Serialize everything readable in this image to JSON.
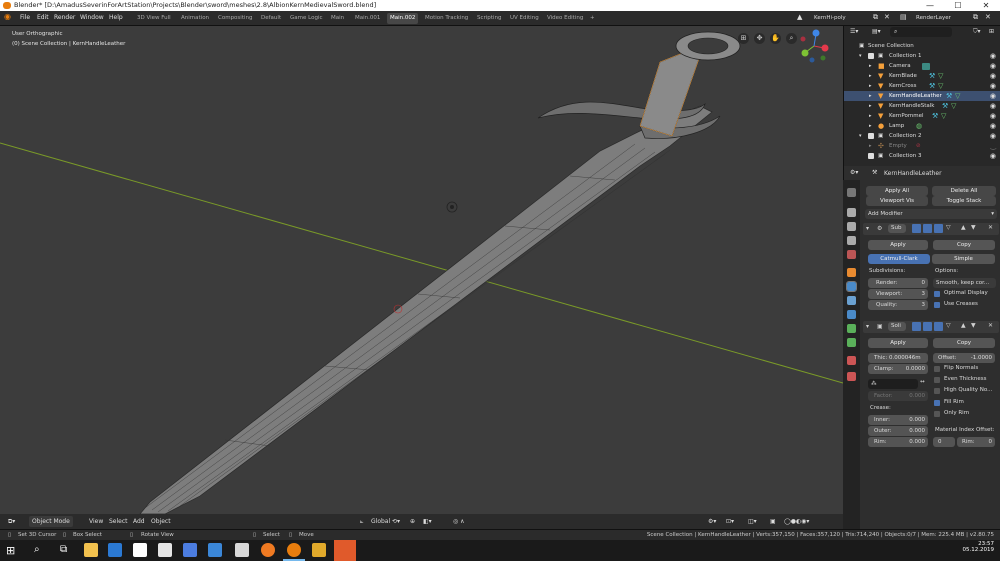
{
  "titlebar": {
    "text": "Blender* [D:\\AmadusSeverinForArtStation\\Projects\\Blender\\sword\\meshes\\2.8\\AlbionKernMedievalSword.blend]",
    "minimize": "—",
    "maximize": "☐",
    "close": "✕"
  },
  "menu": [
    "File",
    "Edit",
    "Render",
    "Window",
    "Help"
  ],
  "workspaces": [
    "3D View Full",
    "Animation",
    "Compositing",
    "Default",
    "Game Logic",
    "Main",
    "Main.001",
    "Main.002",
    "Motion Tracking",
    "Scripting",
    "UV Editing",
    "Video Editing",
    "+"
  ],
  "active_workspace": "Main.002",
  "scene_field": "KernHi-poly",
  "layer_field": "RenderLayer",
  "viewport": {
    "view_name": "User Orthographic",
    "collection_info": "(0) Scene Collection | KernHandleLeather",
    "axis_labels": {
      "x": "X",
      "y": "Y",
      "z": "Z"
    }
  },
  "viewport_header": {
    "mode": "Object Mode",
    "view": "View",
    "select": "Select",
    "add": "Add",
    "object": "Object",
    "orientation": "Global"
  },
  "outliner": {
    "search_placeholder": "",
    "rows": [
      {
        "label": "Scene Collection",
        "type": "scene"
      },
      {
        "label": "Collection 1",
        "type": "collection"
      },
      {
        "label": "Camera",
        "type": "camera"
      },
      {
        "label": "KernBlade",
        "type": "mesh"
      },
      {
        "label": "KernCross",
        "type": "mesh"
      },
      {
        "label": "KernHandleLeather",
        "type": "mesh",
        "selected": true
      },
      {
        "label": "KernHandleStalk",
        "type": "mesh"
      },
      {
        "label": "KernPommel",
        "type": "mesh"
      },
      {
        "label": "Lamp",
        "type": "lamp"
      },
      {
        "label": "Collection 2",
        "type": "collection"
      },
      {
        "label": "Empty",
        "type": "empty"
      },
      {
        "label": "Collection 3",
        "type": "collection"
      }
    ]
  },
  "properties": {
    "object_name": "KernHandleLeather",
    "apply_all": "Apply All",
    "delete_all": "Delete All",
    "viewport_vis": "Viewport Vis",
    "toggle_stack": "Toggle Stack",
    "add_modifier": "Add Modifier",
    "subsurf": {
      "name": "Sub",
      "apply": "Apply",
      "copy": "Copy",
      "catmull": "Catmull-Clark",
      "simple": "Simple",
      "subdivisions_label": "Subdivisions:",
      "options_label": "Options:",
      "render_label": "Render:",
      "render_value": "0",
      "viewport_label": "Viewport:",
      "viewport_value": "3",
      "quality_label": "Quality:",
      "quality_value": "3",
      "uv_smooth": "Smooth, keep cor...",
      "optimal_display": "Optimal Display",
      "use_creases": "Use Creases"
    },
    "solidify": {
      "name": "Soli",
      "apply": "Apply",
      "copy": "Copy",
      "thickness": "Thic: 0.000046m",
      "offset_label": "Offset:",
      "offset_value": "-1.0000",
      "clamp_label": "Clamp:",
      "clamp_value": "0.0000",
      "flip_normals": "Flip Normals",
      "even_thickness": "Even Thickness",
      "high_quality": "High Quality No...",
      "fill_rim": "Fill Rim",
      "only_rim": "Only Rim",
      "factor_label": "Factor:",
      "factor_value": "0.000",
      "crease_label": "Crease:",
      "inner_label": "Inner:",
      "inner_value": "0.000",
      "outer_label": "Outer:",
      "outer_value": "0.000",
      "rim_label": "Rim:",
      "rim_value": "0.000",
      "material_index_label": "Material Index Offset:",
      "mat_value": "0",
      "mat_rim_label": "Rim:",
      "mat_rim_value": "0"
    }
  },
  "statusbar": {
    "set_cursor": "Set 3D Cursor",
    "box_select": "Box Select",
    "rotate_view": "Rotate View",
    "select": "Select",
    "move": "Move",
    "stats": "Scene Collection | KernHandleLeather | Verts:357,150 | Faces:357,120 | Tris:714,240 | Objects:0/7 | Mem: 225.4 MB | v2.80.75"
  },
  "taskbar": {
    "time": "23:57",
    "date": "05.12.2019"
  },
  "colors": {
    "selection_orange": "#f5a03b",
    "active_blue": "#4872b3",
    "x_axis_red": "#e5394b",
    "y_axis_green": "#7ec234",
    "z_axis_blue": "#3f86e6"
  }
}
